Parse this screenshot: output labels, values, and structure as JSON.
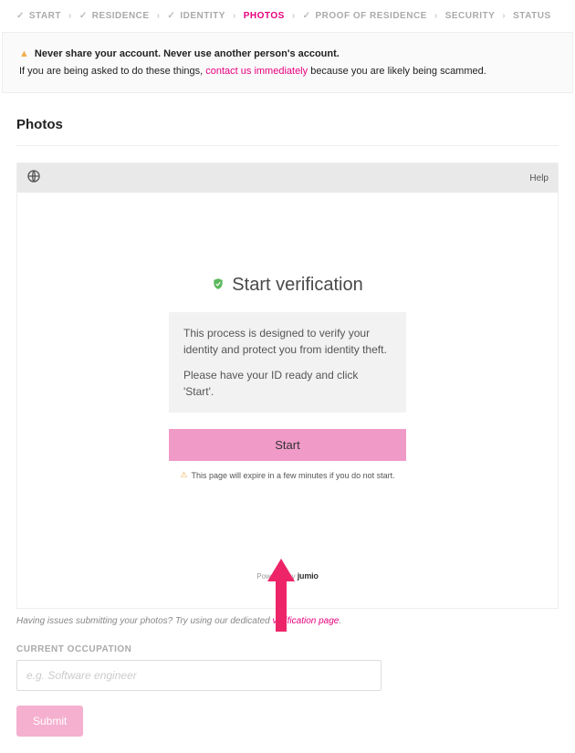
{
  "breadcrumb": {
    "steps": [
      {
        "label": "START",
        "checked": true,
        "active": false
      },
      {
        "label": "RESIDENCE",
        "checked": true,
        "active": false
      },
      {
        "label": "IDENTITY",
        "checked": true,
        "active": false
      },
      {
        "label": "PHOTOS",
        "checked": false,
        "active": true
      },
      {
        "label": "PROOF OF RESIDENCE",
        "checked": true,
        "active": false
      },
      {
        "label": "SECURITY",
        "checked": false,
        "active": false
      },
      {
        "label": "STATUS",
        "checked": false,
        "active": false
      }
    ]
  },
  "warning": {
    "line1": "Never share your account. Never use another person's account.",
    "line2_pre": "If you are being asked to do these things, ",
    "line2_link": "contact us immediately",
    "line2_post": " because you are likely being scammed."
  },
  "section": {
    "title": "Photos"
  },
  "widget": {
    "help": "Help",
    "title": "Start verification",
    "desc1": "This process is designed to verify your identity and protect you from identity theft.",
    "desc2": "Please have your ID ready and click 'Start'.",
    "start_label": "Start",
    "expire": "This page will expire in a few minutes if you do not start.",
    "powered_pre": "Powered by ",
    "powered_brand": "jumio"
  },
  "hint": {
    "pre": "Having issues submitting your photos? Try using our dedicated ",
    "link": "verification page",
    "post": "."
  },
  "occupation": {
    "label": "CURRENT OCCUPATION",
    "placeholder": "e.g. Software engineer"
  },
  "submit": {
    "label": "Submit"
  }
}
